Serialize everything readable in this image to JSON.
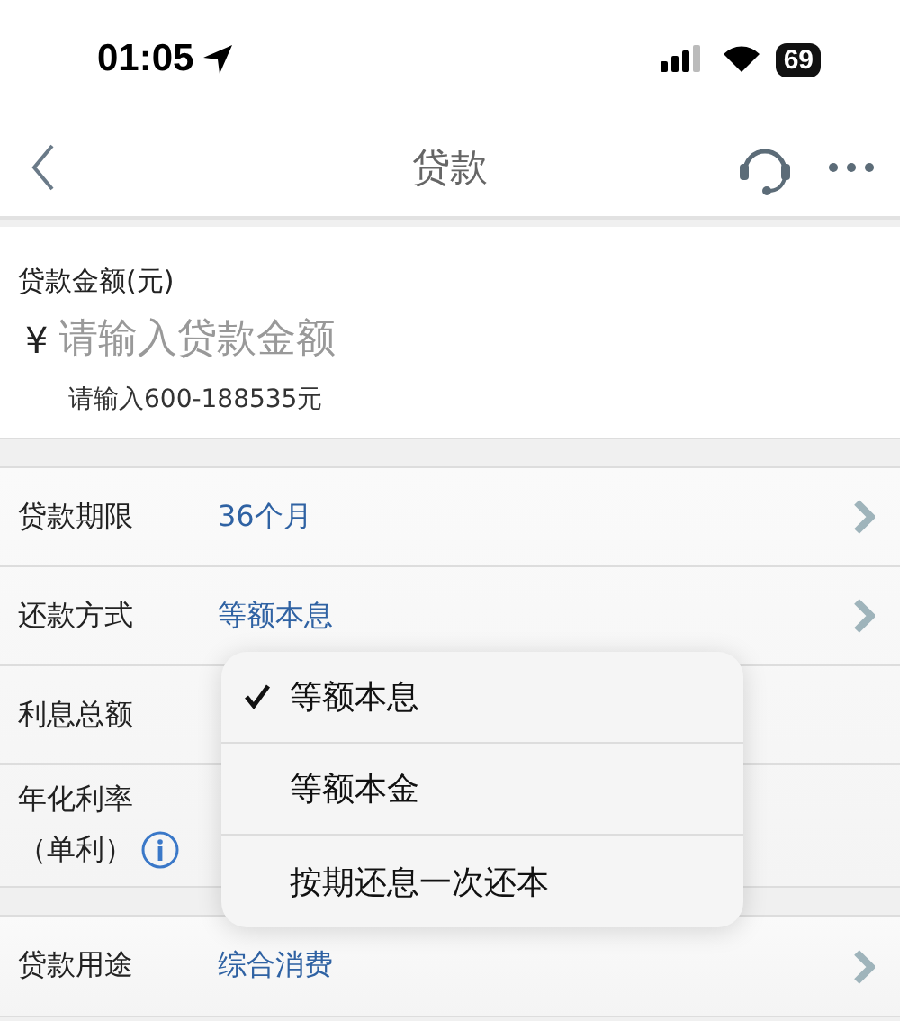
{
  "status_bar": {
    "time": "01:05",
    "battery": "69"
  },
  "nav": {
    "title": "贷款"
  },
  "amount": {
    "label": "贷款金额(元)",
    "currency": "¥",
    "placeholder": "请输入贷款金额",
    "hint": "请输入600-188535元"
  },
  "sections": [
    {
      "rows": [
        {
          "kind": "select",
          "label": "贷款期限",
          "value": "36个月"
        },
        {
          "kind": "select",
          "label": "还款方式",
          "value": "等额本息"
        },
        {
          "kind": "plain",
          "label": "利息总额"
        },
        {
          "kind": "info",
          "label": "年化利率",
          "sublabel": "（单利）"
        }
      ]
    },
    {
      "rows": [
        {
          "kind": "select",
          "label": "贷款用途",
          "value": "综合消费"
        }
      ]
    }
  ],
  "menu": {
    "options": [
      {
        "label": "等额本息",
        "selected": true
      },
      {
        "label": "等额本金",
        "selected": false
      },
      {
        "label": "按期还息一次还本",
        "selected": false
      }
    ]
  }
}
